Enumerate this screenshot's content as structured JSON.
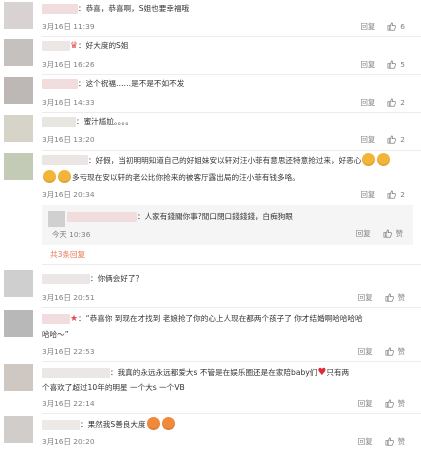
{
  "comments": [
    {
      "prefix": "：",
      "text": "恭喜，恭喜啊，S姐也要幸福哦",
      "time": "3月16日 11:39",
      "reply": "回复",
      "likes": "6"
    },
    {
      "prefix": "：",
      "text": "好大度的S姐",
      "time": "3月16日 16:26",
      "reply": "回复",
      "likes": "5"
    },
    {
      "prefix": "：",
      "text": "这个祝福……是不是不如不发",
      "time": "3月16日 14:33",
      "reply": "回复",
      "likes": "2"
    },
    {
      "prefix": "：",
      "text": "蜜汁尴尬。。。。",
      "time": "3月16日 13:20",
      "reply": "回复",
      "likes": "2"
    },
    {
      "prefix": "：",
      "line1": "好假，当初明明知道自己的好姐妹安以轩对汪小菲有意思还特意抢过来，好恶心",
      "line2": "多亏现在安以轩的老公比你抢来的被客厅露出局的汪小菲有钱多咯。",
      "time": "3月16日 20:34",
      "reply": "回复",
      "likes": "2",
      "nested": {
        "prefix": "：",
        "text": "人家有錢關你事?閒口閉口錢錢錢，白痴狗眼",
        "time": "今天 10:36",
        "reply": "回复",
        "likes": "赞"
      },
      "more": "共3条回复"
    },
    {
      "prefix": "：",
      "text": "你俩会好了？",
      "time": "3月16日 20:51",
      "reply": "回复",
      "likes": "赞"
    },
    {
      "prefix": "：",
      "line1": "“恭喜你 到现在才找到 老娘抢了你的心上人现在都两个孩子了 你才结婚啊哈哈哈哈",
      "line2": "哈哈～”",
      "time": "3月16日 22:53",
      "reply": "回复",
      "likes": "赞"
    },
    {
      "prefix": "：",
      "line1": "我真的永远永远都爱大s 不管是在娱乐圈还是在家陪baby们",
      "line1b": "只有两",
      "line2": "个喜欢了超过10年的明星 一个大s 一个VB",
      "time": "3月16日 22:14",
      "reply": "回复",
      "likes": "赞"
    },
    {
      "prefix": "：",
      "text": "果然我S善良大度",
      "time": "3月16日 20:20",
      "reply": "回复",
      "likes": "赞"
    }
  ]
}
